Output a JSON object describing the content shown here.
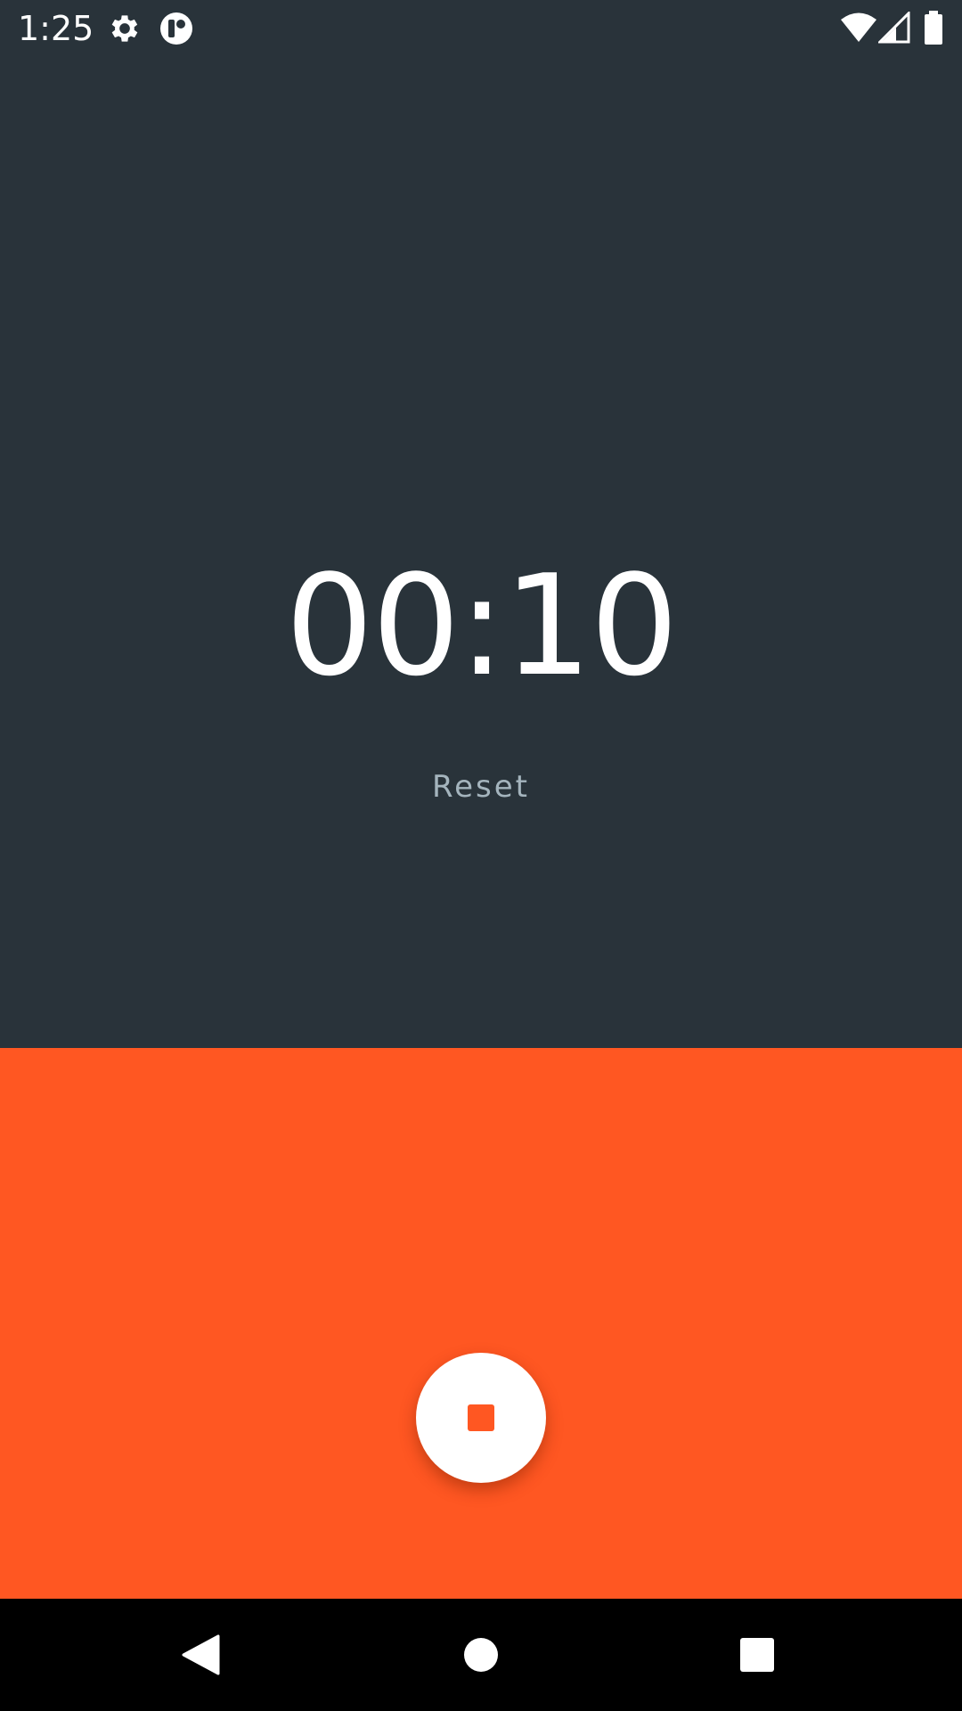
{
  "status_bar": {
    "time": "1:25",
    "left_icons": [
      "gear-icon",
      "app-badge-icon"
    ],
    "right_icons": [
      "wifi-icon",
      "cellular-signal-icon",
      "battery-icon"
    ]
  },
  "timer": {
    "display": "00:10",
    "reset_label": "Reset"
  },
  "controls": {
    "primary_action_icon": "stop-icon"
  },
  "nav_bar": {
    "icons": [
      "back-icon",
      "home-icon",
      "recents-icon"
    ]
  },
  "colors": {
    "background": "#29333a",
    "accent": "#ff5722",
    "reset_text": "#a4b4bd"
  }
}
